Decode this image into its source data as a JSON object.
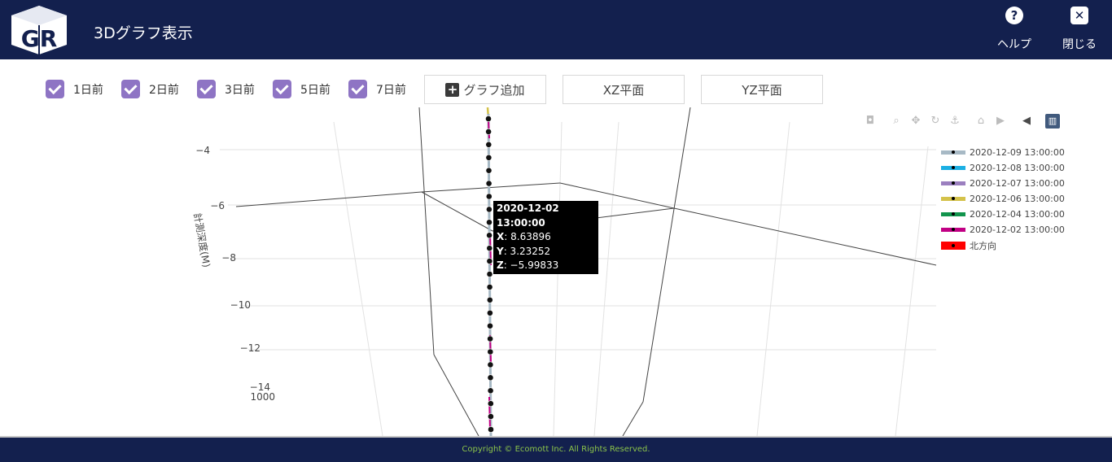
{
  "header": {
    "logo_text": "GR",
    "title": "3Dグラフ表示",
    "help_label": "ヘルプ",
    "close_label": "閉じる"
  },
  "filters": [
    {
      "label": "1日前",
      "checked": true
    },
    {
      "label": "2日前",
      "checked": true
    },
    {
      "label": "3日前",
      "checked": true
    },
    {
      "label": "5日前",
      "checked": true
    },
    {
      "label": "7日前",
      "checked": true
    }
  ],
  "buttons": {
    "add_graph": "グラフ追加",
    "xz_plane": "XZ平面",
    "yz_plane": "YZ平面"
  },
  "modebar_icons": [
    "camera-icon",
    "zoom-icon",
    "pan-icon",
    "orbit-icon",
    "turntable-icon",
    "home-icon",
    "camera-reset-icon",
    "hover-closest-icon",
    "spike-lines-icon"
  ],
  "legend": [
    {
      "name": "2020-12-09 13:00:00",
      "color": "#a7b9c5"
    },
    {
      "name": "2020-12-08 13:00:00",
      "color": "#1cafe3"
    },
    {
      "name": "2020-12-07 13:00:00",
      "color": "#9b7fbf"
    },
    {
      "name": "2020-12-06 13:00:00",
      "color": "#d4c24a"
    },
    {
      "name": "2020-12-04 13:00:00",
      "color": "#11944c"
    },
    {
      "name": "2020-12-02 13:00:00",
      "color": "#c10084"
    },
    {
      "name": "北方向",
      "color": "#ff0000"
    }
  ],
  "tooltip": {
    "title": "2020-12-02 13:00:00",
    "x_label": "X",
    "x_value": ": 8.63896",
    "y_label": "Y",
    "y_value": ": 3.23252",
    "z_label": "Z",
    "z_value": ": −5.99833"
  },
  "axis": {
    "z_title": "計測深度(M)",
    "z_ticks": [
      "−4",
      "−6",
      "−8",
      "−10",
      "−12",
      "−14"
    ],
    "other_tick": "1000"
  },
  "chart_data": {
    "type": "scatter3d",
    "zlabel": "計測深度(M)",
    "z_tick_labels": [
      -4,
      -6,
      -8,
      -10,
      -12,
      -14
    ],
    "series": [
      {
        "name": "2020-12-09 13:00:00"
      },
      {
        "name": "2020-12-08 13:00:00"
      },
      {
        "name": "2020-12-07 13:00:00"
      },
      {
        "name": "2020-12-06 13:00:00"
      },
      {
        "name": "2020-12-04 13:00:00"
      },
      {
        "name": "2020-12-02 13:00:00"
      },
      {
        "name": "北方向"
      }
    ],
    "hover_point": {
      "series": "2020-12-02 13:00:00",
      "x": 8.63896,
      "y": 3.23252,
      "z": -5.99833
    },
    "marker_depths": [
      -3.0,
      -3.5,
      -4.0,
      -4.5,
      -5.0,
      -5.5,
      -6.0,
      -6.5,
      -7.0,
      -7.5,
      -8.0,
      -8.5,
      -9.0,
      -9.5,
      -10.0,
      -10.5,
      -11.0,
      -11.5,
      -12.0,
      -12.5,
      -13.0,
      -13.5,
      -14.0,
      -14.5,
      -15.0
    ]
  },
  "footer": {
    "copyright": "Copyright © Ecomott Inc. All Rights Reserved."
  }
}
